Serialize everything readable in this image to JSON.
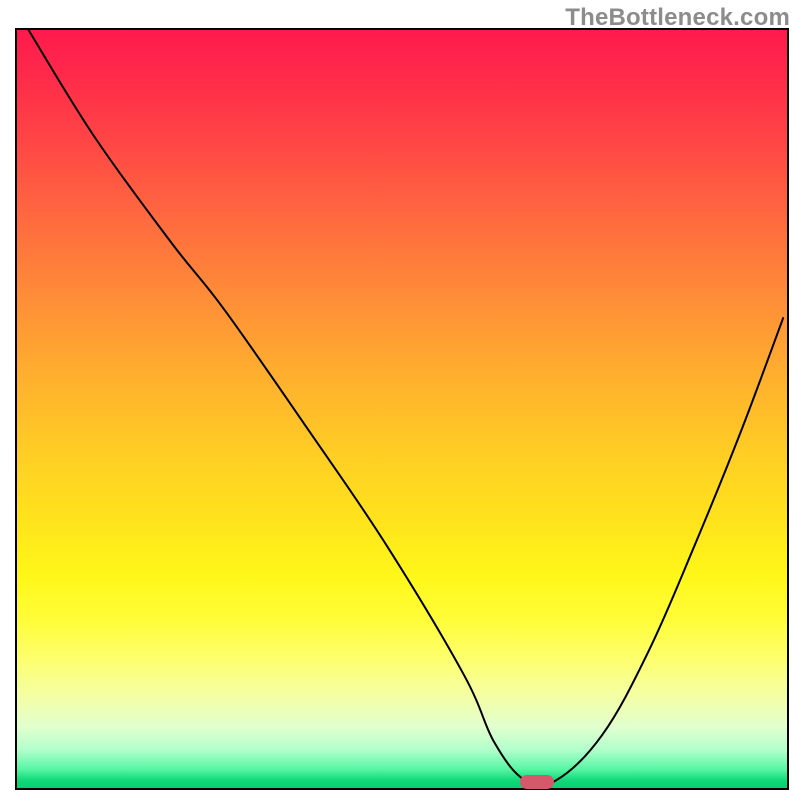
{
  "watermark": "TheBottleneck.com",
  "marker": {
    "x_pct": 67.5,
    "y_pct": 99.2
  },
  "chart_data": {
    "type": "line",
    "title": "",
    "xlabel": "",
    "ylabel": "",
    "xlim": [
      0,
      100
    ],
    "ylim": [
      0,
      100
    ],
    "grid": false,
    "series": [
      {
        "name": "bottleneck-curve",
        "x": [
          1.5,
          10,
          20,
          27,
          38,
          48,
          58,
          62,
          66,
          70,
          76,
          82,
          88,
          94,
          99.5
        ],
        "y": [
          100,
          86,
          72,
          63,
          47,
          32,
          15,
          6,
          1,
          1,
          7,
          18,
          32,
          47,
          62
        ]
      }
    ],
    "annotations": [
      {
        "type": "marker",
        "label": "optimal-point",
        "x": 67.5,
        "y": 0.5
      }
    ],
    "background": "vertical-gradient red→orange→yellow→green"
  }
}
